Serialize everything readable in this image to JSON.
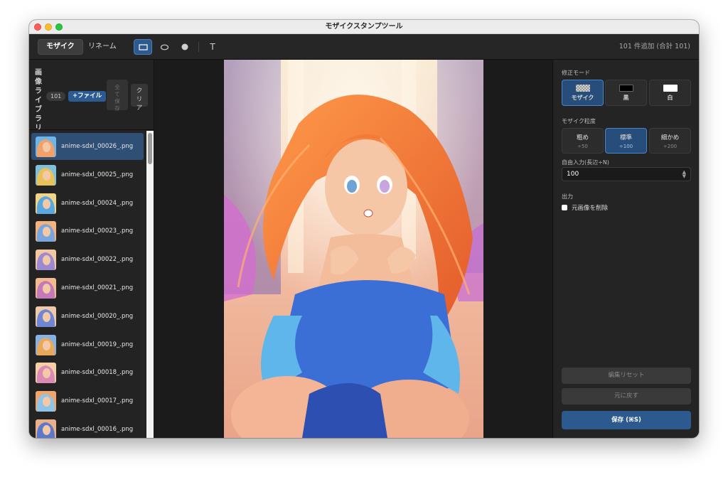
{
  "window": {
    "title": "モザイクスタンプツール"
  },
  "toolbar": {
    "tabs": [
      {
        "label": "モザイク",
        "active": true
      },
      {
        "label": "リネーム",
        "active": false
      }
    ],
    "tools": [
      {
        "icon": "rectangle-icon",
        "active": true
      },
      {
        "icon": "ellipse-icon",
        "active": false
      },
      {
        "icon": "circle-brush-icon",
        "active": false
      },
      {
        "icon": "text-tool-icon",
        "label": "T",
        "active": false
      }
    ],
    "status": "101 件追加 (合計 101)"
  },
  "sidebar": {
    "title": "画像ライブラリ",
    "count": "101",
    "add_file_label": "+ファイル",
    "save_all_label": "全て保存",
    "clear_label": "クリア",
    "files": [
      {
        "name": "anime-sdxl_00026_.png",
        "selected": true
      },
      {
        "name": "anime-sdxl_00025_.png",
        "selected": false
      },
      {
        "name": "anime-sdxl_00024_.png",
        "selected": false
      },
      {
        "name": "anime-sdxl_00023_.png",
        "selected": false
      },
      {
        "name": "anime-sdxl_00022_.png",
        "selected": false
      },
      {
        "name": "anime-sdxl_00021_.png",
        "selected": false
      },
      {
        "name": "anime-sdxl_00020_.png",
        "selected": false
      },
      {
        "name": "anime-sdxl_00019_.png",
        "selected": false
      },
      {
        "name": "anime-sdxl_00018_.png",
        "selected": false
      },
      {
        "name": "anime-sdxl_00017_.png",
        "selected": false
      },
      {
        "name": "anime-sdxl_00016_.png",
        "selected": false
      }
    ]
  },
  "panel": {
    "correction_mode_label": "修正モード",
    "modes": [
      {
        "label": "モザイク",
        "swatch": "mosaic",
        "active": true
      },
      {
        "label": "黒",
        "swatch": "black",
        "active": false
      },
      {
        "label": "白",
        "swatch": "white",
        "active": false
      }
    ],
    "grain_label": "モザイク粒度",
    "grains": [
      {
        "label": "粗め",
        "sub": "÷50",
        "active": false
      },
      {
        "label": "標準",
        "sub": "÷100",
        "active": true
      },
      {
        "label": "細かめ",
        "sub": "÷200",
        "active": false
      }
    ],
    "free_input_label": "自由入力(長辺÷N)",
    "free_input_value": "100",
    "output_label": "出力",
    "delete_original_label": "元画像を削除",
    "reset_edit_label": "編集リセット",
    "undo_label": "元に戻す",
    "save_label": "保存 (⌘S)"
  },
  "colors": {
    "accent": "#2c5a8f",
    "selected_row": "#2f4f74",
    "background": "#1e1e1e"
  }
}
